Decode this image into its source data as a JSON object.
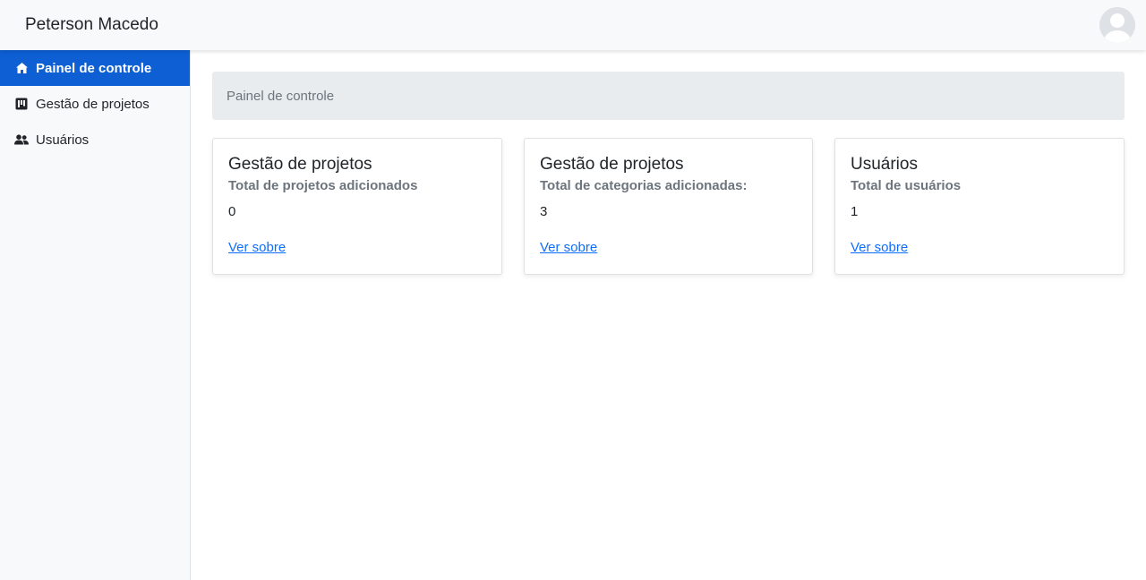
{
  "header": {
    "brand": "Peterson Macedo",
    "avatar_icon": "user-avatar-icon"
  },
  "sidebar": {
    "items": [
      {
        "label": "Painel de controle",
        "icon": "home-icon",
        "active": true
      },
      {
        "label": "Gestão de projetos",
        "icon": "kanban-icon",
        "active": false
      },
      {
        "label": "Usuários",
        "icon": "users-icon",
        "active": false
      }
    ]
  },
  "main": {
    "breadcrumb": "Painel de controle",
    "cards": [
      {
        "title": "Gestão de projetos",
        "subtitle": "Total de projetos adicionados",
        "value": "0",
        "link": "Ver sobre"
      },
      {
        "title": "Gestão de projetos",
        "subtitle": "Total de categorias adicionadas:",
        "value": "3",
        "link": "Ver sobre"
      },
      {
        "title": "Usuários",
        "subtitle": "Total de usuários",
        "value": "1",
        "link": "Ver sobre"
      }
    ]
  },
  "colors": {
    "accent": "#0d5fd3",
    "link": "#0d6efd",
    "sidebar_bg": "#f8f9fa",
    "breadcrumb_bg": "#e9ecef"
  }
}
